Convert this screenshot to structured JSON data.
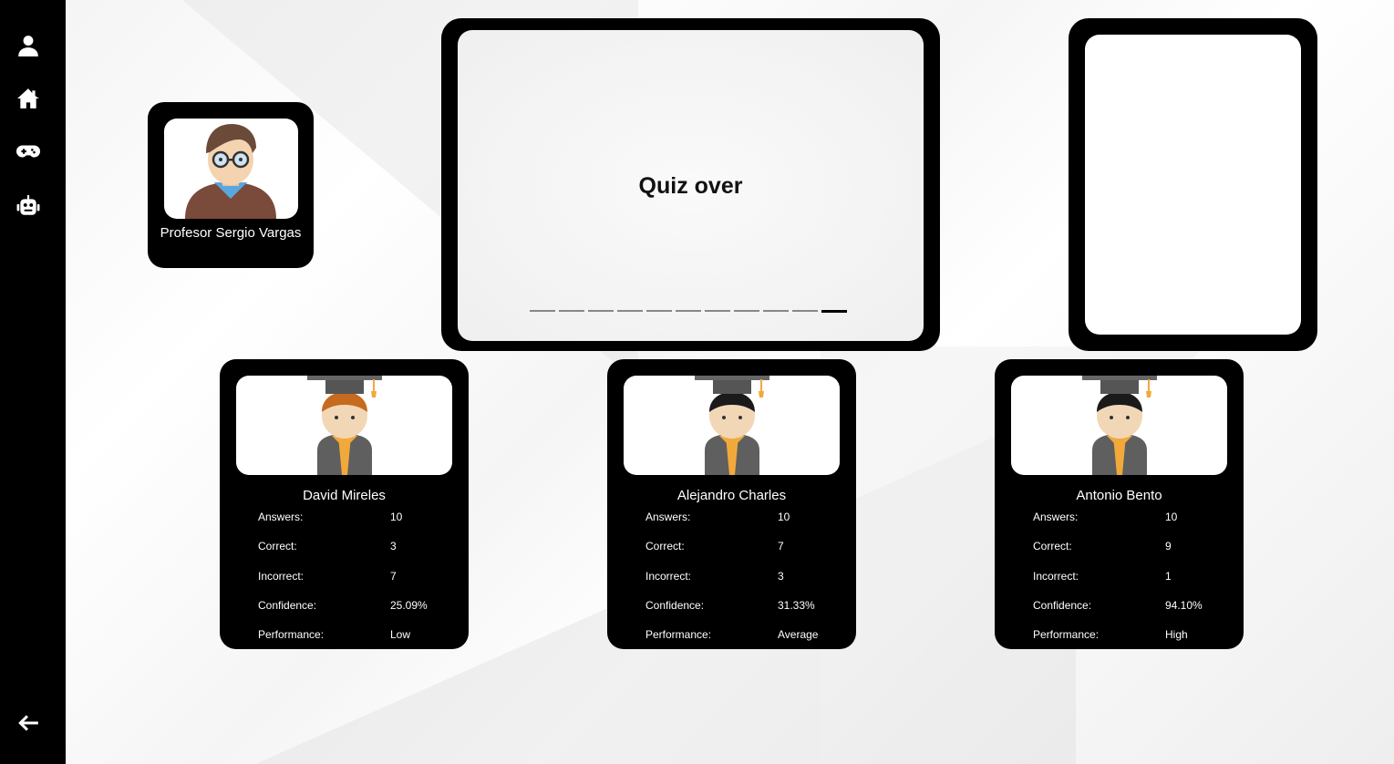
{
  "sidebar": {
    "items": [
      {
        "icon": "user-icon"
      },
      {
        "icon": "home-icon"
      },
      {
        "icon": "gamepad-icon"
      },
      {
        "icon": "robot-icon"
      }
    ],
    "back_icon": "arrow-left-icon"
  },
  "teacher": {
    "name": "Profesor Sergio Vargas"
  },
  "quiz": {
    "title": "Quiz over",
    "progress_total": 11,
    "progress_current": 11
  },
  "stat_labels": {
    "answers": "Answers:",
    "correct": "Correct:",
    "incorrect": "Incorrect:",
    "confidence": "Confidence:",
    "performance": "Performance:"
  },
  "students": [
    {
      "name": "David Mireles",
      "answers": "10",
      "correct": "3",
      "incorrect": "7",
      "confidence": "25.09%",
      "performance": "Low",
      "hair": "#c56a1f"
    },
    {
      "name": "Alejandro Charles",
      "answers": "10",
      "correct": "7",
      "incorrect": "3",
      "confidence": "31.33%",
      "performance": "Average",
      "hair": "#1a1a1a"
    },
    {
      "name": "Antonio Bento",
      "answers": "10",
      "correct": "9",
      "incorrect": "1",
      "confidence": "94.10%",
      "performance": "High",
      "hair": "#1a1a1a"
    }
  ],
  "colors": {
    "sidebar": "#000000",
    "card": "#000000",
    "gown": "#5f5f5f",
    "stole": "#f2a93b",
    "skin": "#f2d7b6"
  }
}
